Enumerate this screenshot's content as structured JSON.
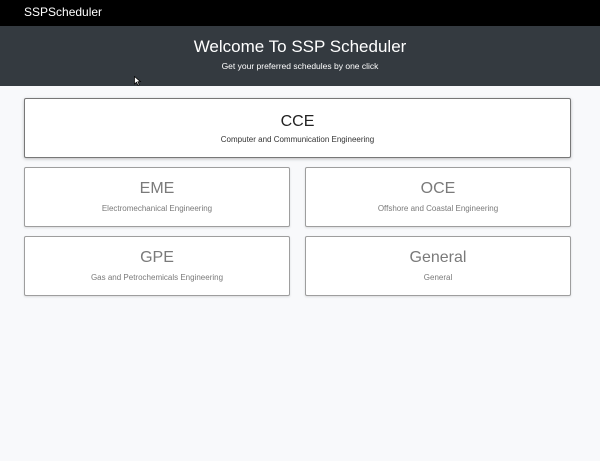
{
  "navbar": {
    "brand": "SSPScheduler"
  },
  "hero": {
    "title": "Welcome To SSP Scheduler",
    "subtitle": "Get your preferred schedules by one click"
  },
  "departments": [
    {
      "code": "CCE",
      "name": "Computer and Communication Engineering"
    },
    {
      "code": "EME",
      "name": "Electromechanical Engineering"
    },
    {
      "code": "OCE",
      "name": "Offshore and Coastal Engineering"
    },
    {
      "code": "GPE",
      "name": "Gas and Petrochemicals Engineering"
    },
    {
      "code": "General",
      "name": "General"
    }
  ],
  "colors": {
    "navbar_bg": "#000000",
    "hero_bg": "#343a40",
    "page_bg": "#f8f9fb"
  }
}
